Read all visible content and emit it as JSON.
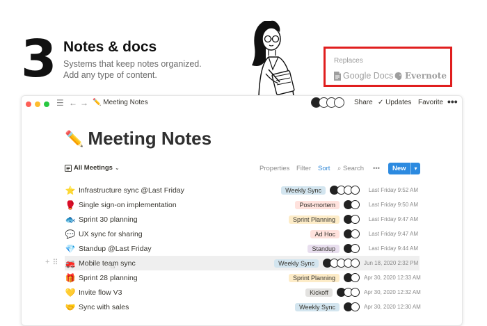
{
  "hero": {
    "number": "3",
    "title": "Notes & docs",
    "subtitle_line1": "Systems that keep notes organized.",
    "subtitle_line2": "Add any type of content."
  },
  "replaces": {
    "label": "Replaces",
    "items": [
      {
        "name": "Google Docs",
        "icon": "google-docs-icon"
      },
      {
        "name": "Evernote",
        "icon": "evernote-elephant-icon"
      }
    ]
  },
  "window": {
    "breadcrumb": "Meeting Notes",
    "breadcrumb_icon": "✏️",
    "actions": {
      "share": "Share",
      "updates": "Updates",
      "favorite": "Favorite",
      "more": "•••"
    },
    "updates_icon": "check-icon"
  },
  "page": {
    "icon": "✏️",
    "title": "Meeting Notes",
    "view": "All Meetings",
    "toolbar": {
      "properties": "Properties",
      "filter": "Filter",
      "sort": "Sort",
      "search": "Search",
      "more": "•••",
      "new": "New"
    }
  },
  "colors": {
    "accent": "#2c8ae0",
    "highlight_box": "#e01e1e",
    "tag_weekly_sync": "#d3e5ef",
    "tag_post_mortem": "#ffe2dd",
    "tag_sprint_planning": "#fdecc8",
    "tag_ad_hoc": "#ffe2dd",
    "tag_standup": "#e8deee",
    "tag_kickoff": "#e3e2e0"
  },
  "rows": [
    {
      "emoji": "⭐",
      "name": "Infrastructure sync @Last Friday",
      "tag": "Weekly Sync",
      "tag_color": "#d3e5ef",
      "avatars": 4,
      "date": "Last Friday 9:52 AM"
    },
    {
      "emoji": "🥊",
      "name": "Single sign-on implementation",
      "tag": "Post-mortem",
      "tag_color": "#ffe2dd",
      "avatars": 2,
      "date": "Last Friday 9:50 AM"
    },
    {
      "emoji": "🐟",
      "name": "Sprint 30 planning",
      "tag": "Sprint Planning",
      "tag_color": "#fdecc8",
      "avatars": 2,
      "date": "Last Friday 9:47 AM"
    },
    {
      "emoji": "💬",
      "name": "UX sync for sharing",
      "tag": "Ad Hoc",
      "tag_color": "#ffe2dd",
      "avatars": 2,
      "date": "Last Friday 9:47 AM"
    },
    {
      "emoji": "💎",
      "name": "Standup @Last Friday",
      "tag": "Standup",
      "tag_color": "#e8deee",
      "avatars": 2,
      "date": "Last Friday 9:44 AM"
    },
    {
      "emoji": "🚒",
      "name": "Mobile team sync",
      "tag": "Weekly Sync",
      "tag_color": "#d3e5ef",
      "avatars": 5,
      "date": "Jun 18, 2020 2:32 PM"
    },
    {
      "emoji": "🎁",
      "name": "Sprint 28 planning",
      "tag": "Sprint Planning",
      "tag_color": "#fdecc8",
      "avatars": 2,
      "date": "Apr 30, 2020 12:33 AM"
    },
    {
      "emoji": "💛",
      "name": "Invite flow V3",
      "tag": "Kickoff",
      "tag_color": "#e3e2e0",
      "avatars": 3,
      "date": "Apr 30, 2020 12:32 AM"
    },
    {
      "emoji": "🤝",
      "name": "Sync with sales",
      "tag": "Weekly Sync",
      "tag_color": "#d3e5ef",
      "avatars": 2,
      "date": "Apr 30, 2020 12:30 AM"
    }
  ]
}
